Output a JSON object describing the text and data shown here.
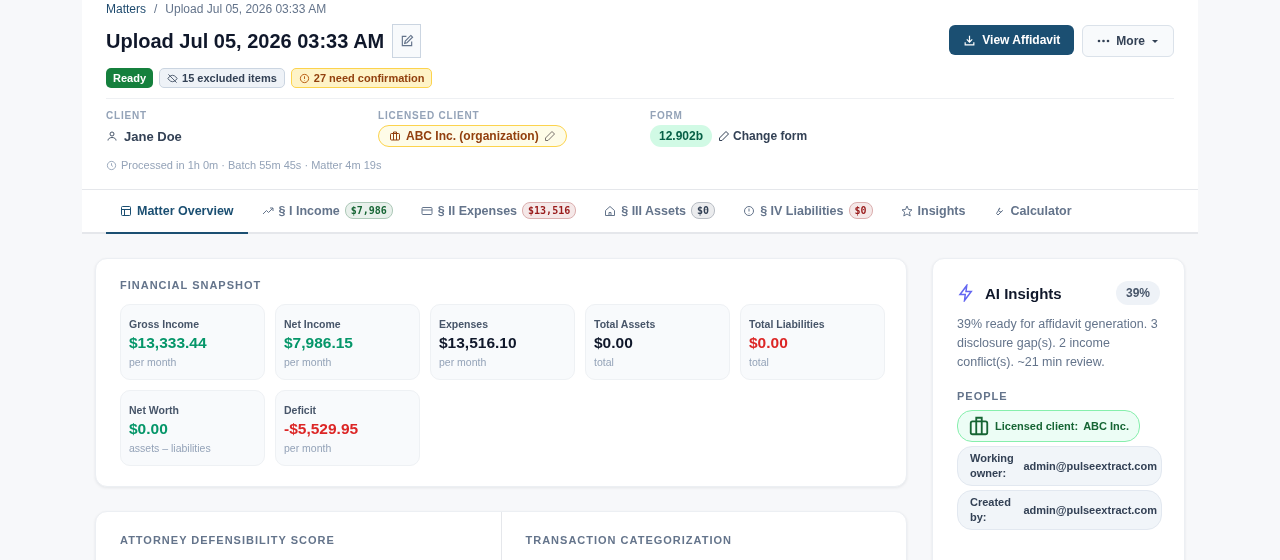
{
  "breadcrumb": {
    "parent": "Matters",
    "separator": "/",
    "current": "Upload Jul 05, 2026 03:33 AM"
  },
  "title": "Upload Jul 05, 2026 03:33 AM",
  "actions": {
    "primary": "View Affidavit",
    "more": "More"
  },
  "badges": [
    {
      "kind": "status",
      "label": "Ready"
    },
    {
      "kind": "excluded",
      "label": "15 excluded items"
    },
    {
      "kind": "warning",
      "label": "27 need confirmation"
    }
  ],
  "client": {
    "label": "CLIENT",
    "name": "Jane Doe"
  },
  "licensed_client": {
    "label": "LICENSED CLIENT",
    "name": "ABC Inc. (organization)"
  },
  "form": {
    "label": "FORM",
    "value": "12.902b",
    "change": "Change form"
  },
  "processing": "Processed in 1h 0m · Batch 55m 45s · Matter 4m 19s",
  "tabs": [
    {
      "label": "Matter Overview",
      "selected": true
    },
    {
      "label": "§ I Income",
      "selected": false,
      "badge": "$7,986",
      "color": "#166534"
    },
    {
      "label": "§ II Expenses",
      "selected": false,
      "badge": "$13,516",
      "color": "#991b1b"
    },
    {
      "label": "§ III Assets",
      "selected": false,
      "badge": "$0",
      "color": "#334155"
    },
    {
      "label": "§ IV Liabilities",
      "selected": false,
      "badge": "$0",
      "color": "#991b1b"
    },
    {
      "label": "Insights",
      "selected": false
    },
    {
      "label": "Calculator",
      "selected": false
    }
  ],
  "snapshot": {
    "title": "FINANCIAL SNAPSHOT",
    "metrics": [
      {
        "label": "Gross Income",
        "value": "$13,333.44",
        "note": "per month",
        "color": "#059669"
      },
      {
        "label": "Net Income",
        "value": "$7,986.15",
        "note": "per month",
        "color": "#059669"
      },
      {
        "label": "Expenses",
        "value": "$13,516.10",
        "note": "per month",
        "color": "#0f172a"
      },
      {
        "label": "Total Assets",
        "value": "$0.00",
        "note": "total",
        "color": "#0f172a"
      },
      {
        "label": "Total Liabilities",
        "value": "$0.00",
        "note": "total",
        "color": "#dc2626"
      },
      {
        "label": "Net Worth",
        "value": "$0.00",
        "note": "assets – liabilities",
        "color": "#059669"
      },
      {
        "label": "Deficit",
        "value": "-$5,529.95",
        "note": "per month",
        "color": "#dc2626"
      }
    ]
  },
  "lower_sections": [
    "ATTORNEY DEFENSIBILITY SCORE",
    "TRANSACTION CATEGORIZATION"
  ],
  "insights": {
    "title": "AI Insights",
    "score": "39%",
    "summary": "39% ready for affidavit generation. 3 disclosure gap(s). 2 income conflict(s). ~21 min review.",
    "people_title": "PEOPLE",
    "people": [
      {
        "kind": "licensed",
        "label": "Licensed client:",
        "value": "ABC Inc."
      },
      {
        "kind": "plain",
        "label": "Working owner:",
        "value": "admin@pulseextract.com"
      },
      {
        "kind": "plain",
        "label": "Created by:",
        "value": "admin@pulseextract.com"
      }
    ]
  }
}
